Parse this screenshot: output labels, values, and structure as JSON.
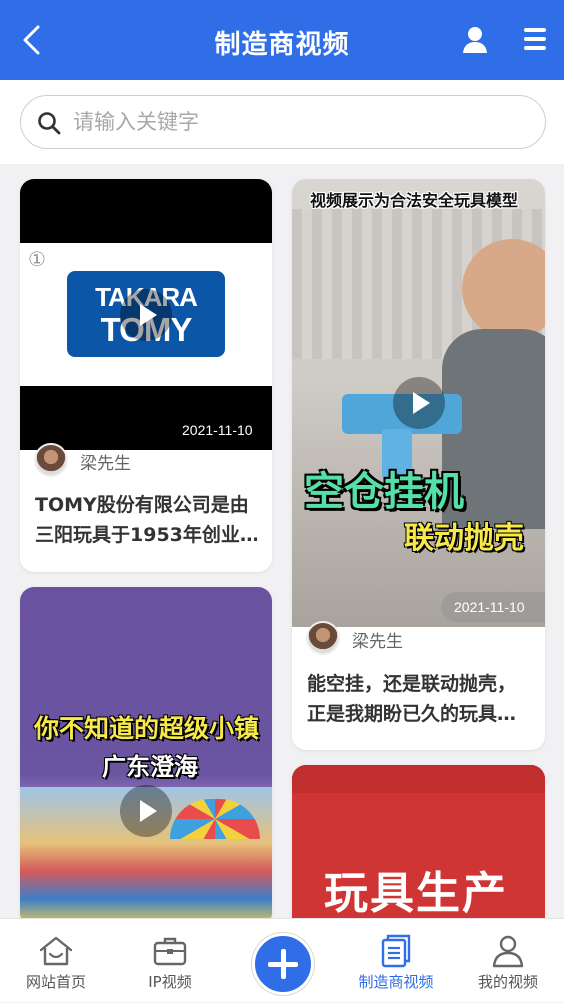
{
  "header": {
    "title": "制造商视频"
  },
  "search": {
    "placeholder": "请输入关键字",
    "value": ""
  },
  "videos": [
    {
      "date": "2021-11-10",
      "author": "梁先生",
      "desc_lines": [
        "TOMY股份有限公司是由",
        "三阳玩具于1953年创业…"
      ],
      "logo_lines": [
        "TAKARA",
        "TOMY"
      ],
      "badge": "①"
    },
    {
      "date": "2021-11-10",
      "author": "梁先生",
      "desc_lines": [
        "能空挂，还是联动抛壳，",
        "正是我期盼已久的玩具…"
      ],
      "banner": "视频展示为合法安全玩具模型",
      "overlay_1": "空仓挂机",
      "overlay_2": "联动抛壳"
    },
    {
      "overlay_1": "你不知道的超级小镇",
      "overlay_2": "广东澄海"
    },
    {
      "overlay_1": "玩具生产"
    }
  ],
  "tabbar": {
    "items": [
      {
        "label": "网站首页",
        "icon": "home-icon"
      },
      {
        "label": "IP视频",
        "icon": "briefcase-icon"
      },
      {
        "label": "制造商视频",
        "icon": "document-icon"
      },
      {
        "label": "我的视频",
        "icon": "person-icon"
      }
    ],
    "active_color": "#2f6ee6"
  }
}
